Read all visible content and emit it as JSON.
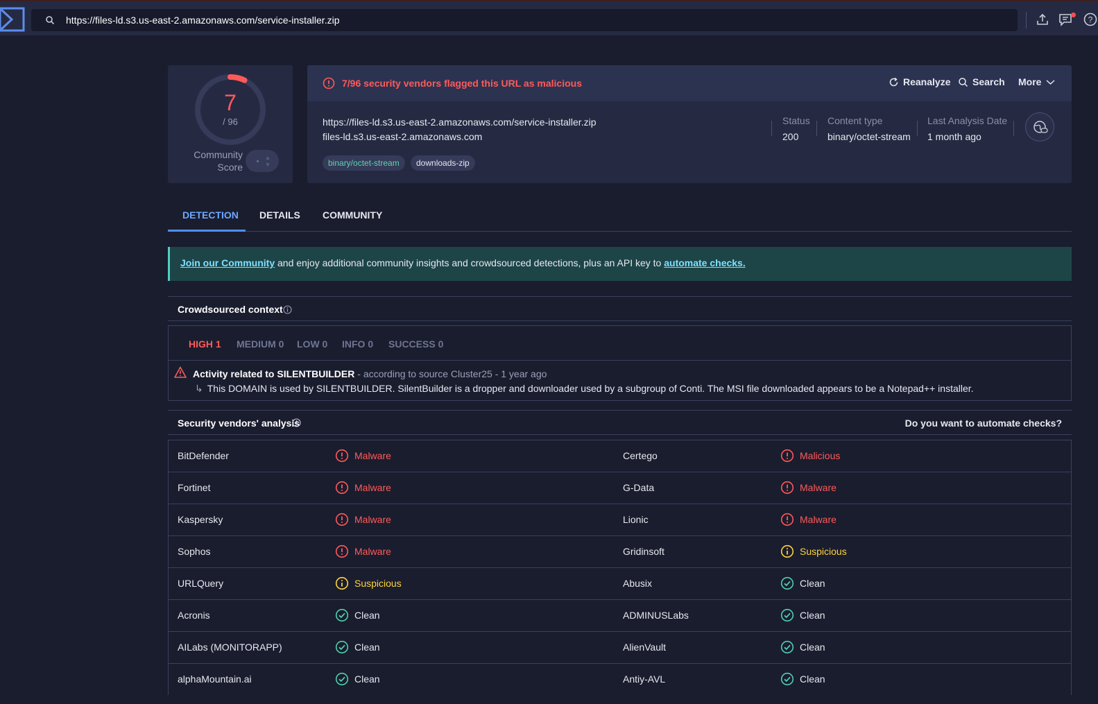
{
  "search": {
    "value": "https://files-ld.s3.us-east-2.amazonaws.com/service-installer.zip"
  },
  "score": {
    "detections": "7",
    "total": "/ 96",
    "community_label": "Community Score"
  },
  "header": {
    "alert": "7/96 security vendors flagged this URL as malicious",
    "reanalyze": "Reanalyze",
    "search": "Search",
    "more": "More",
    "url": "https://files-ld.s3.us-east-2.amazonaws.com/service-installer.zip",
    "host": "files-ld.s3.us-east-2.amazonaws.com",
    "tags": [
      "binary/octet-stream",
      "downloads-zip"
    ],
    "status_label": "Status",
    "status_value": "200",
    "content_type_label": "Content type",
    "content_type_value": "binary/octet-stream",
    "last_analysis_label": "Last Analysis Date",
    "last_analysis_value": "1 month ago"
  },
  "tabs": [
    "DETECTION",
    "DETAILS",
    "COMMUNITY"
  ],
  "banner": {
    "link1": "Join our Community",
    "text": " and enjoy additional community insights and crowdsourced detections, plus an API key to ",
    "link2": "automate checks."
  },
  "crowdsourced": {
    "title": "Crowdsourced context",
    "severities": [
      "HIGH 1",
      "MEDIUM 0",
      "LOW 0",
      "INFO 0",
      "SUCCESS 0"
    ],
    "activity_title": "Activity related to SILENTBUILDER",
    "activity_meta": " - according to source Cluster25 - 1 year ago",
    "activity_arrow": "↳",
    "activity_desc": "This DOMAIN is used by SILENTBUILDER. SilentBuilder is a dropper and downloader used by a subgroup of Conti. The MSI file downloaded appears to be a Notepad++ installer."
  },
  "vendors": {
    "title": "Security vendors' analysis",
    "automate": "Do you want to automate checks?",
    "rows": [
      [
        {
          "name": "BitDefender",
          "result": "Malware",
          "status": "malware"
        },
        {
          "name": "Certego",
          "result": "Malicious",
          "status": "malware"
        }
      ],
      [
        {
          "name": "Fortinet",
          "result": "Malware",
          "status": "malware"
        },
        {
          "name": "G-Data",
          "result": "Malware",
          "status": "malware"
        }
      ],
      [
        {
          "name": "Kaspersky",
          "result": "Malware",
          "status": "malware"
        },
        {
          "name": "Lionic",
          "result": "Malware",
          "status": "malware"
        }
      ],
      [
        {
          "name": "Sophos",
          "result": "Malware",
          "status": "malware"
        },
        {
          "name": "Gridinsoft",
          "result": "Suspicious",
          "status": "suspicious"
        }
      ],
      [
        {
          "name": "URLQuery",
          "result": "Suspicious",
          "status": "suspicious"
        },
        {
          "name": "Abusix",
          "result": "Clean",
          "status": "clean"
        }
      ],
      [
        {
          "name": "Acronis",
          "result": "Clean",
          "status": "clean"
        },
        {
          "name": "ADMINUSLabs",
          "result": "Clean",
          "status": "clean"
        }
      ],
      [
        {
          "name": "AILabs (MONITORAPP)",
          "result": "Clean",
          "status": "clean"
        },
        {
          "name": "AlienVault",
          "result": "Clean",
          "status": "clean"
        }
      ],
      [
        {
          "name": "alphaMountain.ai",
          "result": "Clean",
          "status": "clean"
        },
        {
          "name": "Antiy-AVL",
          "result": "Clean",
          "status": "clean"
        }
      ]
    ]
  },
  "colors": {
    "malicious": "#ff5a5a",
    "suspicious": "#ffd43b",
    "clean": "#4fd0b0",
    "accent": "#4f8dff"
  }
}
